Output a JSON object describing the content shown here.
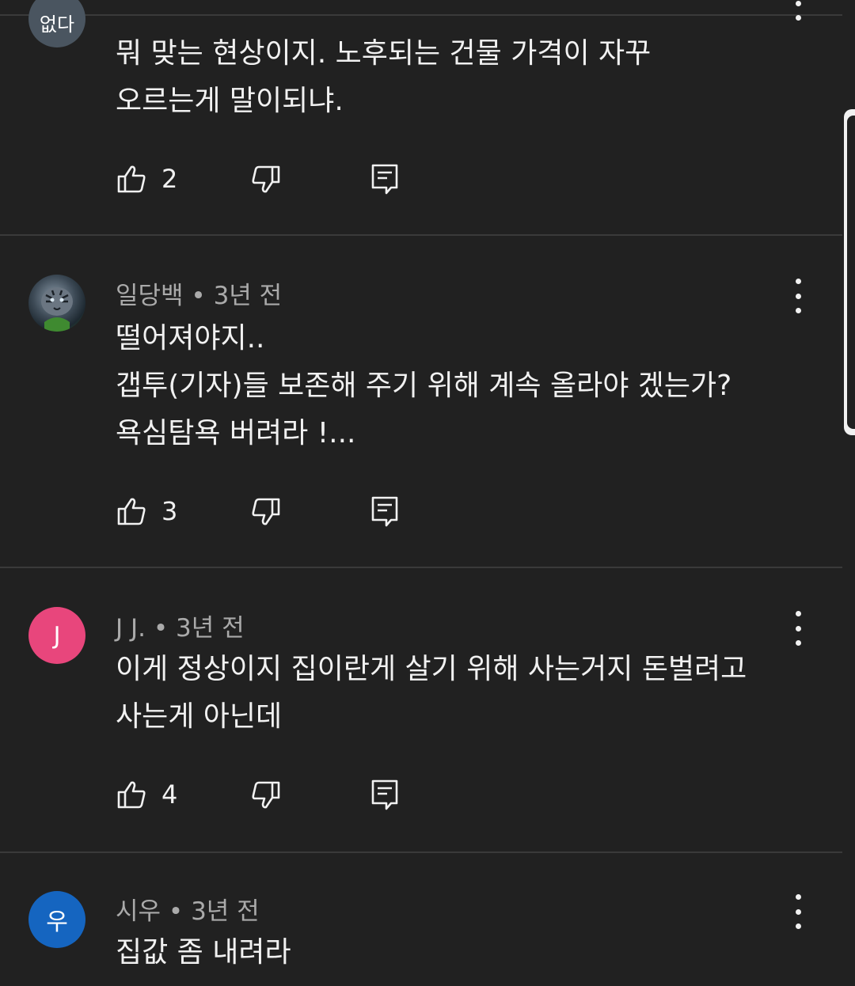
{
  "colors": {
    "background": "#212121",
    "text": "#f1f1f1",
    "meta": "#aaaaaa",
    "avatar_j": "#e8467c",
    "avatar_woo": "#1565c0"
  },
  "icons": {
    "like": "thumbs-up-icon",
    "dislike": "thumbs-down-icon",
    "reply": "reply-comment-icon",
    "menu": "more-vertical-icon"
  },
  "comments": [
    {
      "avatar_text": "없다",
      "text": "뭐 맞는 현상이지. 노후되는 건물 가격이 자꾸\n오르는게 말이되냐.",
      "likes": "2"
    },
    {
      "author": "일당백",
      "separator": "•",
      "time": "3년 전",
      "text": "떨어져야지..\n갭투(기자)들 보존해 주기 위해 계속 올라야 겠는가?\n욕심탐욕 버려라 !...",
      "likes": "3"
    },
    {
      "avatar_text": "J",
      "author": "J J.",
      "separator": "•",
      "time": "3년 전",
      "text": "이게 정상이지  집이란게 살기 위해 사는거지 돈벌려고\n사는게 아닌데",
      "likes": "4"
    },
    {
      "avatar_text": "우",
      "author": "시우",
      "separator": "•",
      "time": "3년 전",
      "text": "집값 좀 내려라"
    }
  ]
}
